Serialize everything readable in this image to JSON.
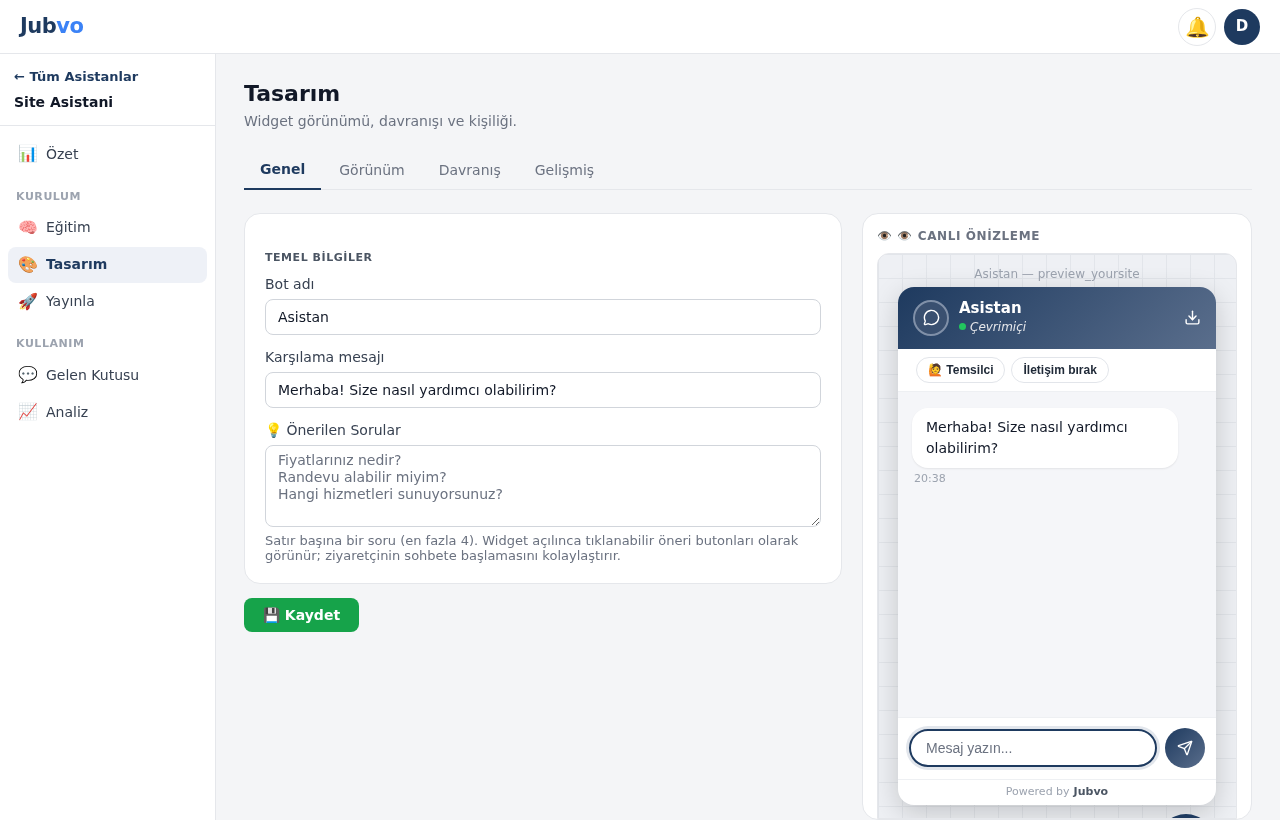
{
  "header": {
    "logo_a": "Jub",
    "logo_b": "vo",
    "bell": "🔔",
    "avatar": "D"
  },
  "sidebar": {
    "back": "← Tüm Asistanlar",
    "assistant": "Site Asistani",
    "items": [
      {
        "kind": "item",
        "icon": "📊",
        "label": "Özet",
        "selected": false
      },
      {
        "kind": "section",
        "label": "KURULUM"
      },
      {
        "kind": "item",
        "icon": "🧠",
        "label": "Eğitim",
        "selected": false
      },
      {
        "kind": "item",
        "icon": "🎨",
        "label": "Tasarım",
        "selected": true
      },
      {
        "kind": "item",
        "icon": "🚀",
        "label": "Yayınla",
        "selected": false
      },
      {
        "kind": "section",
        "label": "KULLANIM"
      },
      {
        "kind": "item",
        "icon": "💬",
        "label": "Gelen Kutusu",
        "selected": false
      },
      {
        "kind": "item",
        "icon": "📈",
        "label": "Analiz",
        "selected": false
      }
    ]
  },
  "page": {
    "title": "Tasarım",
    "subtitle": "Widget görünümü, davranışı ve kişiliği."
  },
  "tabs": [
    {
      "label": "Genel",
      "selected": true
    },
    {
      "label": "Görünüm",
      "selected": false
    },
    {
      "label": "Davranış",
      "selected": false
    },
    {
      "label": "Gelişmiş",
      "selected": false
    }
  ],
  "form": {
    "section": "TEMEL BİLGİLER",
    "fields": [
      {
        "kind": "input",
        "label": "Bot adı",
        "value": "Asistan"
      },
      {
        "kind": "input",
        "label": "Karşılama mesajı",
        "value": "Merhaba! Size nasıl yardımcı olabilirim?"
      },
      {
        "kind": "textarea",
        "label": "💡 Önerilen Sorular",
        "placeholder": "Fiyatlarınız nedir?\nRandevu alabilir miyim?\nHangi hizmetleri sunuyorsunuz?",
        "help": "Satır başına bir soru (en fazla 4). Widget açılınca tıklanabilir öneri butonları olarak görünür; ziyaretçinin sohbete başlamasını kolaylaştırır."
      }
    ],
    "save": "💾 Kaydet"
  },
  "preview": {
    "title": "👁️ 👁️ CANLI ÖNİZLEME",
    "site_caption": "Asistan — preview_yoursite",
    "widget": {
      "name": "Asistan",
      "online": true,
      "status": "Çevrimiçi",
      "chips": [
        "🙋 Temsilci",
        "İletişim bırak"
      ],
      "messages": [
        {
          "text": "Merhaba! Size nasıl yardımcı olabilirim?",
          "time": "20:38"
        }
      ],
      "input_placeholder": "Mesaj yazın...",
      "powered": "Powered by",
      "powered_brand": "Jubvo"
    }
  }
}
